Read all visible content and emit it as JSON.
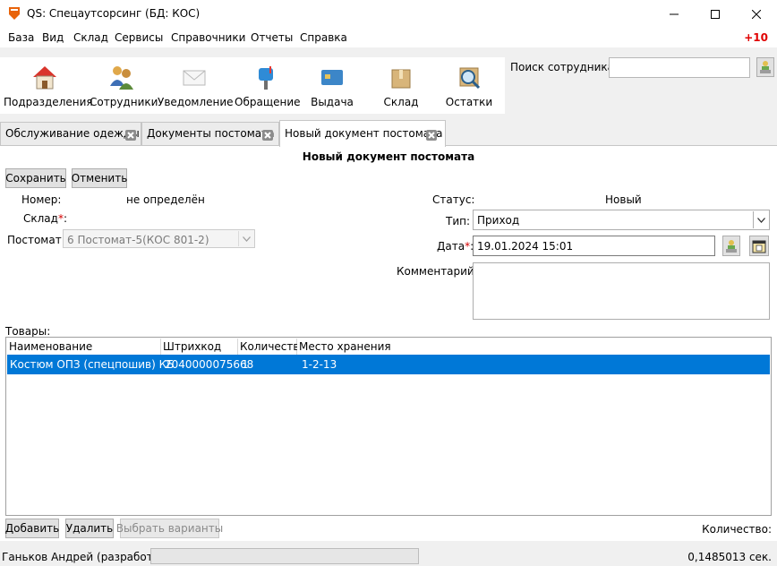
{
  "window": {
    "title": "QS: Спецаутсорсинг (БД: КОС)"
  },
  "menu": {
    "items": [
      "База",
      "Вид",
      "Склад",
      "Сервисы",
      "Справочники",
      "Отчеты",
      "Справка"
    ],
    "badge": "+10"
  },
  "toolbar": {
    "buttons": [
      {
        "label": "Подразделения",
        "icon": "house-icon"
      },
      {
        "label": "Сотрудники",
        "icon": "people-icon"
      },
      {
        "label": "Уведомление",
        "icon": "envelope-icon"
      },
      {
        "label": "Обращение",
        "icon": "mailbox-icon"
      },
      {
        "label": "Выдача",
        "icon": "card-icon"
      },
      {
        "label": "Склад",
        "icon": "box-icon"
      },
      {
        "label": "Остатки",
        "icon": "magnifier-icon"
      }
    ]
  },
  "search": {
    "label": "Поиск сотрудника:",
    "value": ""
  },
  "tabs": [
    {
      "label": "Обслуживание одежды",
      "active": false
    },
    {
      "label": "Документы постомата",
      "active": false
    },
    {
      "label": "Новый документ постомата",
      "active": true
    }
  ],
  "document": {
    "title": "Новый документ постомата",
    "save_label": "Сохранить",
    "cancel_label": "Отменить",
    "number_label": "Номер:",
    "number_value": "не определён",
    "warehouse_label": "Склад",
    "postomat_label": "Постомат:",
    "postomat_value": "6 Постомат-5(КОС 801-2)",
    "status_label": "Статус:",
    "status_value": "Новый",
    "type_label": "Тип:",
    "type_value": "Приход",
    "date_label": "Дата",
    "date_value": "19.01.2024 15:01",
    "comment_label": "Комментарий:",
    "comment_value": "",
    "required_mark": "*",
    "colon": ":"
  },
  "goods": {
    "label": "Товары:",
    "columns": [
      "Наименование",
      "Штрихкод",
      "Количество",
      "Место хранения"
    ],
    "rows": [
      {
        "name": "Костюм ОПЗ (спецпошив) КБ",
        "barcode": "2040000075668",
        "qty": "1",
        "location": "1-2-13"
      }
    ],
    "add_label": "Добавить",
    "delete_label": "Удалить",
    "variants_label": "Выбрать варианты",
    "count_label": "Количество:"
  },
  "statusbar": {
    "user": "Ганьков Андрей (разработка)",
    "time": "0,1485013 сек."
  },
  "colors": {
    "accent": "#0078d7",
    "badge": "#e00000",
    "required": "#d40000"
  }
}
